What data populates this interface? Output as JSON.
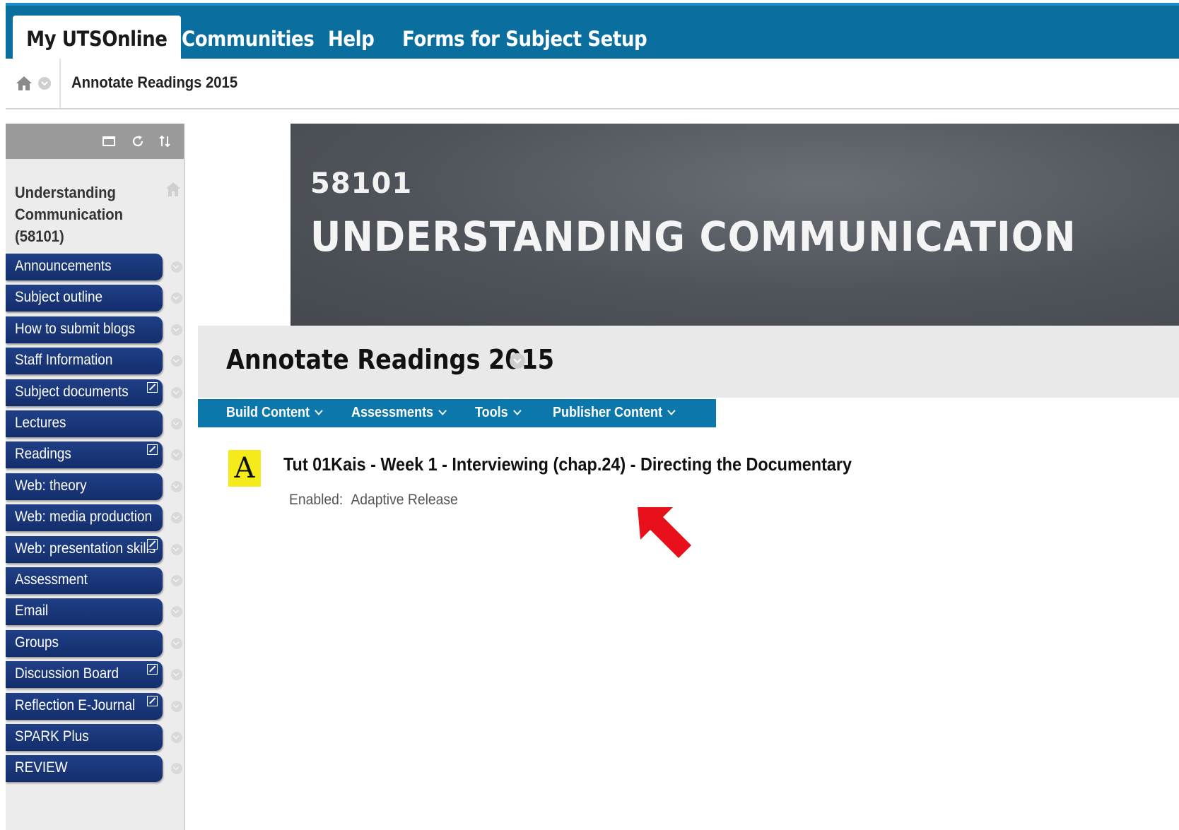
{
  "topnav": {
    "tabs": [
      "My UTSOnline",
      "Communities",
      "Help",
      "Forms for Subject Setup"
    ]
  },
  "breadcrumb": {
    "current": "Annotate Readings 2015"
  },
  "sidebar": {
    "course_title_lines": [
      "Understanding",
      "Communication",
      "(58101)"
    ],
    "items": [
      {
        "label": "Announcements",
        "hidden": false
      },
      {
        "label": "Subject outline",
        "hidden": false
      },
      {
        "label": "How to submit blogs",
        "hidden": false
      },
      {
        "label": "Staff Information",
        "hidden": false
      },
      {
        "label": "Subject documents",
        "hidden": true
      },
      {
        "label": "Lectures",
        "hidden": false
      },
      {
        "label": "Readings",
        "hidden": true
      },
      {
        "label": "Web: theory",
        "hidden": false
      },
      {
        "label": "Web: media production",
        "hidden": false
      },
      {
        "label": "Web: presentation skills",
        "hidden": true
      },
      {
        "label": "Assessment",
        "hidden": false
      },
      {
        "label": "Email",
        "hidden": false
      },
      {
        "label": "Groups",
        "hidden": false
      },
      {
        "label": "Discussion Board",
        "hidden": true
      },
      {
        "label": "Reflection E-Journal",
        "hidden": true
      },
      {
        "label": "SPARK Plus",
        "hidden": false
      },
      {
        "label": "REVIEW",
        "hidden": false
      }
    ]
  },
  "banner": {
    "code": "58101",
    "title": "UNDERSTANDING COMMUNICATION"
  },
  "content": {
    "page_title": "Annotate Readings 2015",
    "actions": [
      "Build Content",
      "Assessments",
      "Tools",
      "Publisher Content"
    ],
    "item": {
      "icon_letter": "A",
      "title": "Tut 01Kais - Week 1 - Interviewing (chap.24) - Directing the Documentary",
      "status_label": "Enabled:",
      "status_value": "Adaptive Release"
    }
  },
  "colors": {
    "topbar": "#0a6e9e",
    "menu_item": "#1f3f86",
    "actionbar": "#0c77aa",
    "item_icon": "#f5ea1a",
    "annotation_arrow": "#e8111b"
  }
}
